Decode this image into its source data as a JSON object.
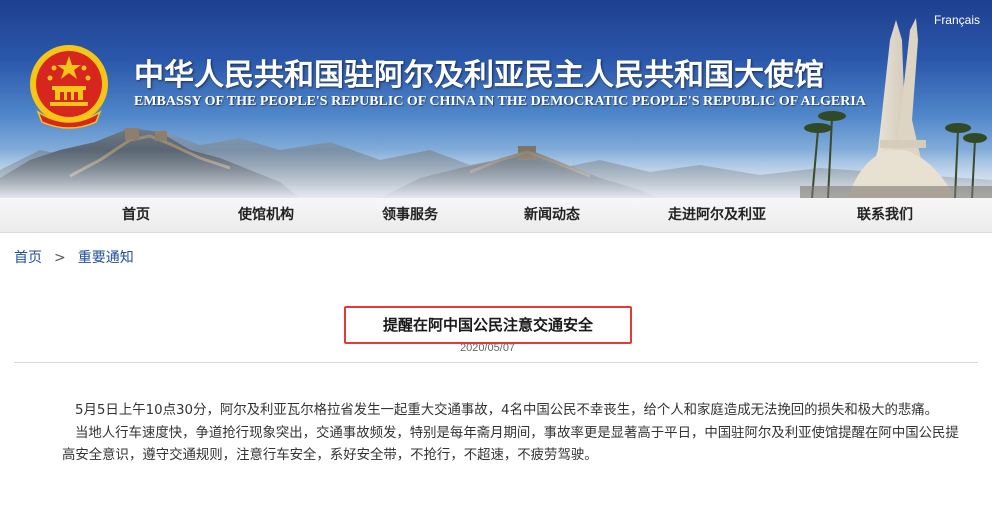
{
  "header": {
    "language_link": "Français",
    "title_zh": "中华人民共和国驻阿尔及利亚民主人民共和国大使馆",
    "title_en": "EMBASSY OF THE PEOPLE'S REPUBLIC OF CHINA IN THE DEMOCRATIC PEOPLE'S REPUBLIC OF ALGERIA",
    "emblem_icon": "national-emblem-icon",
    "colors": {
      "sky": "#2b57ab",
      "emblem_red": "#d7261e",
      "emblem_gold": "#f5c518"
    }
  },
  "nav": {
    "items": [
      {
        "label": "首页"
      },
      {
        "label": "使馆机构"
      },
      {
        "label": "领事服务"
      },
      {
        "label": "新闻动态"
      },
      {
        "label": "走进阿尔及利亚"
      },
      {
        "label": "联系我们"
      }
    ]
  },
  "breadcrumb": {
    "home": "首页",
    "separator": ">",
    "current": "重要通知"
  },
  "article": {
    "title": "提醒在阿中国公民注意交通安全",
    "date": "2020/05/07",
    "highlight_color": "#e53935",
    "paragraphs": [
      "5月5日上午10点30分，阿尔及利亚瓦尔格拉省发生一起重大交通事故，4名中国公民不幸丧生，给个人和家庭造成无法挽回的损失和极大的悲痛。",
      "当地人行车速度快，争道抢行现象突出，交通事故频发，特别是每年斋月期间，事故率更是显著高于平日，中国驻阿尔及利亚使馆提醒在阿中国公民提高安全意识，遵守交通规则，注意行车安全，系好安全带，不抢行，不超速，不疲劳驾驶。"
    ]
  }
}
